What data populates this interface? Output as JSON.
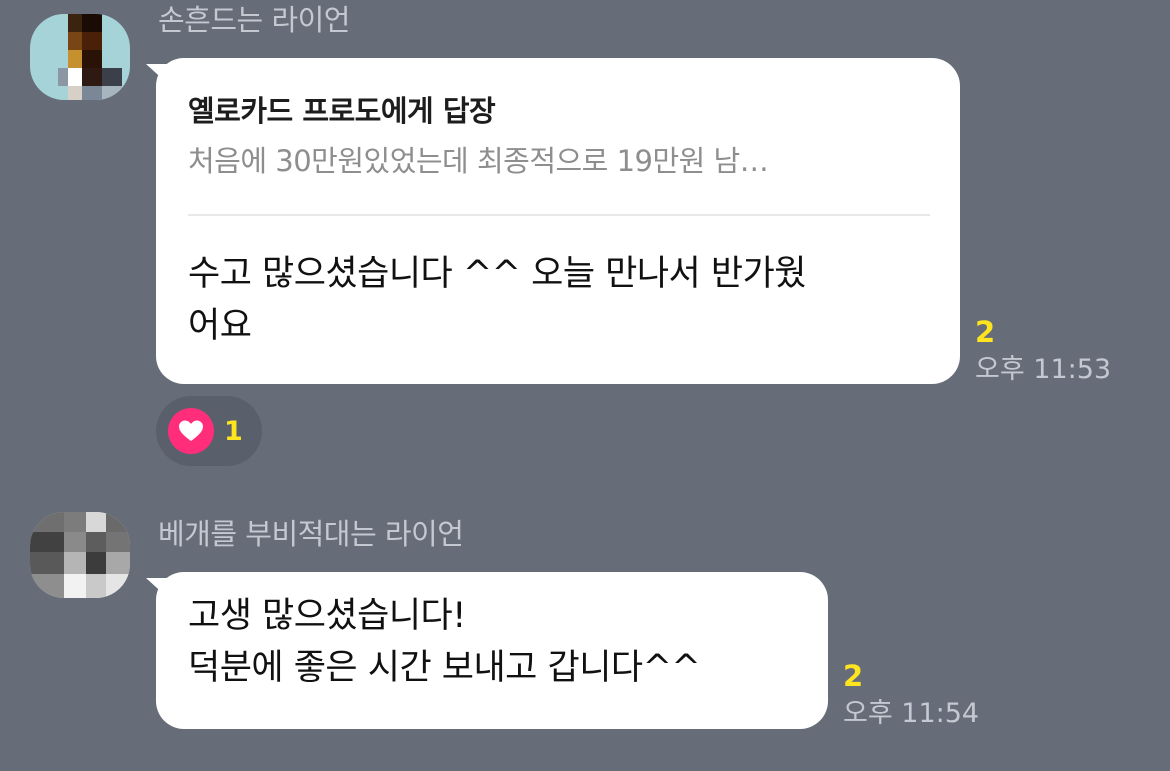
{
  "messages": [
    {
      "sender": "손흔드는 라이언",
      "reply": {
        "title": "옐로카드 프로도에게 답장",
        "preview": "처음에 30만원있었는데 최종적으로 19만원 남…"
      },
      "text_lines": [
        "수고 많으셨습니다 ^^ 오늘 만나서 반가웠",
        "어요"
      ],
      "unread": "2",
      "time": "오후 11:53",
      "reaction": {
        "icon": "heart-icon",
        "count": "1"
      }
    },
    {
      "sender": "베개를 부비적대는 라이언",
      "text_lines": [
        "고생 많으셨습니다!",
        "덕분에 좋은 시간 보내고 갑니다^^"
      ],
      "unread": "2",
      "time": "오후 11:54"
    }
  ],
  "colors": {
    "background": "#666c78",
    "bubble": "#ffffff",
    "unread": "#ffe51f",
    "heart": "#ff2d7a",
    "meta_text": "#c4c8d0"
  }
}
